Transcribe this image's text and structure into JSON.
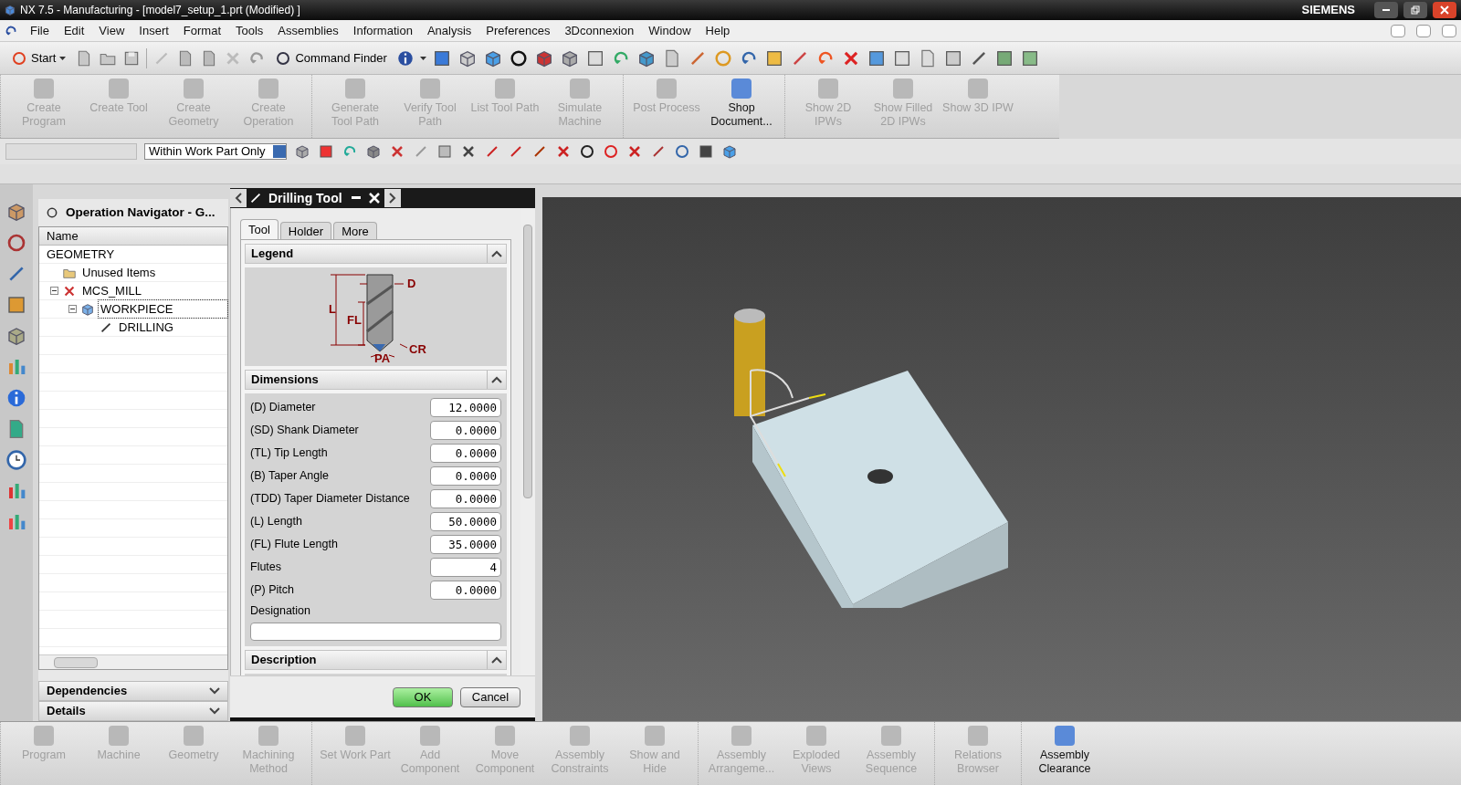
{
  "window": {
    "title": "NX 7.5 - Manufacturing - [model7_setup_1.prt (Modified) ]",
    "brand": "SIEMENS"
  },
  "menu": [
    "File",
    "Edit",
    "View",
    "Insert",
    "Format",
    "Tools",
    "Assemblies",
    "Information",
    "Analysis",
    "Preferences",
    "3Dconnexion",
    "Window",
    "Help"
  ],
  "toolbar": {
    "start": "Start",
    "command_finder": "Command Finder"
  },
  "ribbon": [
    {
      "buttons": [
        {
          "label": "Create Program",
          "disabled": true
        },
        {
          "label": "Create Tool",
          "disabled": true
        },
        {
          "label": "Create Geometry",
          "disabled": true
        },
        {
          "label": "Create Operation",
          "disabled": true
        }
      ]
    },
    {
      "buttons": [
        {
          "label": "Generate Tool Path",
          "disabled": true
        },
        {
          "label": "Verify Tool Path",
          "disabled": true
        },
        {
          "label": "List Tool Path",
          "disabled": true
        },
        {
          "label": "Simulate Machine",
          "disabled": true
        }
      ]
    },
    {
      "buttons": [
        {
          "label": "Post Process",
          "disabled": true
        },
        {
          "label": "Shop Document...",
          "disabled": false
        }
      ]
    },
    {
      "buttons": [
        {
          "label": "Show 2D IPWs",
          "disabled": true
        },
        {
          "label": "Show Filled 2D IPWs",
          "disabled": true
        },
        {
          "label": "Show 3D IPW",
          "disabled": true
        }
      ]
    }
  ],
  "selection_bar": {
    "filter": "Within Work Part Only"
  },
  "navigator": {
    "title": "Operation Navigator - G...",
    "column": "Name",
    "tree": [
      {
        "label": "GEOMETRY",
        "selected": false,
        "children": [
          {
            "label": "Unused Items",
            "kind": "folder",
            "selected": false
          },
          {
            "label": "MCS_MILL",
            "kind": "mcs",
            "selected": false,
            "expanded": true,
            "children": [
              {
                "label": "WORKPIECE",
                "kind": "workpiece",
                "selected": true,
                "expanded": true,
                "children": [
                  {
                    "label": "DRILLING",
                    "kind": "operation",
                    "selected": false
                  }
                ]
              }
            ]
          }
        ]
      }
    ],
    "panels": [
      {
        "label": "Dependencies",
        "expanded": false
      },
      {
        "label": "Details",
        "expanded": false
      }
    ]
  },
  "dialog": {
    "title": "Drilling Tool",
    "tabs": [
      {
        "label": "Tool",
        "selected": true
      },
      {
        "label": "Holder",
        "selected": false
      },
      {
        "label": "More",
        "selected": false
      }
    ],
    "sections": [
      {
        "title": "Legend",
        "kind": "legend",
        "expanded": true,
        "labels": [
          "D",
          "L",
          "FL",
          "CR",
          "PA"
        ]
      },
      {
        "title": "Dimensions",
        "kind": "fields",
        "expanded": true,
        "fields": [
          {
            "label": "(D) Diameter",
            "value": "12.0000"
          },
          {
            "label": "(SD) Shank Diameter",
            "value": "0.0000"
          },
          {
            "label": "(TL) Tip Length",
            "value": "0.0000"
          },
          {
            "label": "(B) Taper Angle",
            "value": "0.0000"
          },
          {
            "label": "(TDD) Taper Diameter Distance",
            "value": "0.0000"
          },
          {
            "label": "(L) Length",
            "value": "50.0000"
          },
          {
            "label": "(FL) Flute Length",
            "value": "35.0000"
          },
          {
            "label": "Flutes",
            "value": "4"
          },
          {
            "label": "(P) Pitch",
            "value": "0.0000"
          }
        ],
        "designation": "Designation"
      },
      {
        "title": "Description",
        "kind": "text",
        "expanded": true
      }
    ],
    "buttons": [
      "OK",
      "Cancel"
    ]
  },
  "bottom_ribbon": [
    {
      "buttons": [
        {
          "label": "Program",
          "disabled": true
        },
        {
          "label": "Machine",
          "disabled": true
        },
        {
          "label": "Geometry",
          "disabled": true
        },
        {
          "label": "Machining Method",
          "disabled": true
        }
      ]
    },
    {
      "buttons": [
        {
          "label": "Set Work Part",
          "disabled": true
        },
        {
          "label": "Add Component",
          "disabled": true
        },
        {
          "label": "Move Component",
          "disabled": true
        },
        {
          "label": "Assembly Constraints",
          "disabled": true
        },
        {
          "label": "Show and Hide",
          "disabled": true
        }
      ]
    },
    {
      "buttons": [
        {
          "label": "Assembly Arrangeme...",
          "disabled": true
        },
        {
          "label": "Exploded Views",
          "disabled": true
        },
        {
          "label": "Assembly Sequence",
          "disabled": true
        }
      ]
    },
    {
      "buttons": [
        {
          "label": "Relations Browser",
          "disabled": true
        }
      ]
    },
    {
      "buttons": [
        {
          "label": "Assembly Clearance",
          "disabled": false
        }
      ]
    }
  ]
}
